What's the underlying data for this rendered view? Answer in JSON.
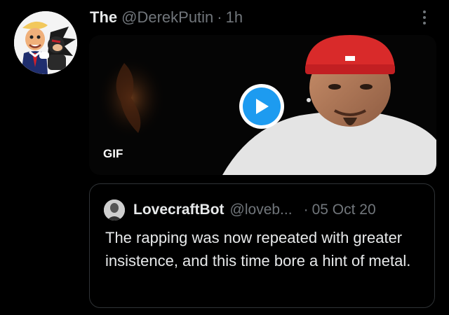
{
  "tweet": {
    "display_name": "The",
    "handle": "@DerekPutin",
    "separator": "·",
    "time": "1h",
    "avatar_icon": "cartoon-avatar-icon",
    "more_icon": "more-dots-icon"
  },
  "media": {
    "badge": "GIF",
    "play_icon": "play-icon",
    "accent": "#1d9bf0"
  },
  "quote": {
    "name": "LovecraftBot",
    "handle": "@loveb...",
    "separator": "·",
    "date": "05 Oct 20",
    "text": "The rapping was now repeated with greater insistence, and this time bore a hint of metal."
  }
}
